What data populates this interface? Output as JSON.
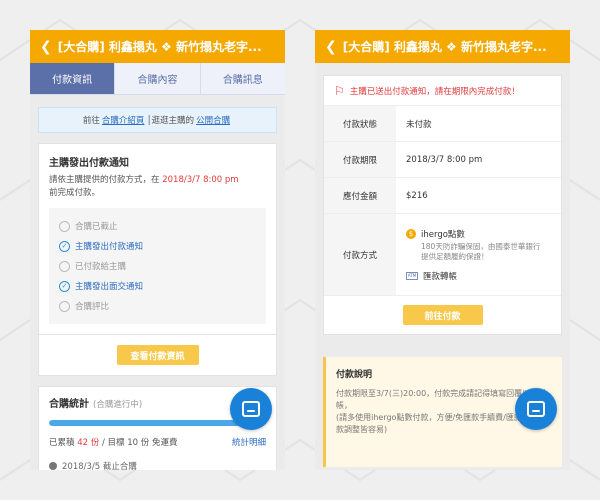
{
  "left": {
    "header": {
      "title": "[大合購] 利鑫搨丸 ❖ 新竹搨丸老字..."
    },
    "tabs": [
      {
        "label": "付款資訊"
      },
      {
        "label": "合購內容"
      },
      {
        "label": "合購訊息"
      }
    ],
    "notice": {
      "prefix": "前往",
      "link1": "合購介紹頁",
      "middle": "│逛逛主購的",
      "link2": "公開合購"
    },
    "payment_notice": {
      "title": "主購發出付款通知",
      "desc_prefix": "請依主購提供的付款方式，在",
      "deadline": "2018/3/7  8:00 pm",
      "desc_suffix": "前完成付款。",
      "steps": [
        {
          "label": "合購已截止",
          "done": false
        },
        {
          "label": "主購發出付款通知",
          "done": true
        },
        {
          "label": "已付款給主購",
          "done": false
        },
        {
          "label": "主購發出面交通知",
          "done": true
        },
        {
          "label": "合購評比",
          "done": false
        }
      ],
      "button": "查看付款資訊"
    },
    "stats": {
      "title": "合購統計",
      "status": "(合購進行中)",
      "progress": 0.97,
      "summary_prefix": "已累積",
      "count": "42 份",
      "summary_suffix": "/ 目標 10 份 免運費",
      "link": "統計明細",
      "date": "2018/3/5 截止合購"
    }
  },
  "right": {
    "header": {
      "title": "[大合購] 利鑫搨丸 ❖ 新竹搨丸老字..."
    },
    "alert": "主購已送出付款通知，請在期限內完成付款！",
    "rows": {
      "status": {
        "key": "付款狀態",
        "value": "未付款"
      },
      "deadline": {
        "key": "付款期限",
        "value": "2018/3/7  8:00 pm"
      },
      "amount": {
        "key": "應付金額",
        "value": "$216"
      },
      "method": {
        "key": "付款方式",
        "opt1": "ihergo點數",
        "opt1_sub": "180天防詐騙保固，由國泰世華銀行提供足額履約保證！",
        "opt2": "匯款轉帳"
      }
    },
    "button": "前往付款",
    "explain": {
      "title": "付款說明",
      "line1": "付款期限至3/7(三)20:00，付款完成請記得填寫回覆以利對帳，",
      "line2": "(請多使用ihergo點數付款，方便/免匯款手續費/匯款對帳退款調整皆容易)"
    }
  },
  "colors": {
    "accent": "#f5a800",
    "tab": "#5b6fa8",
    "red": "#e13b3b",
    "fab": "#1982d8"
  }
}
